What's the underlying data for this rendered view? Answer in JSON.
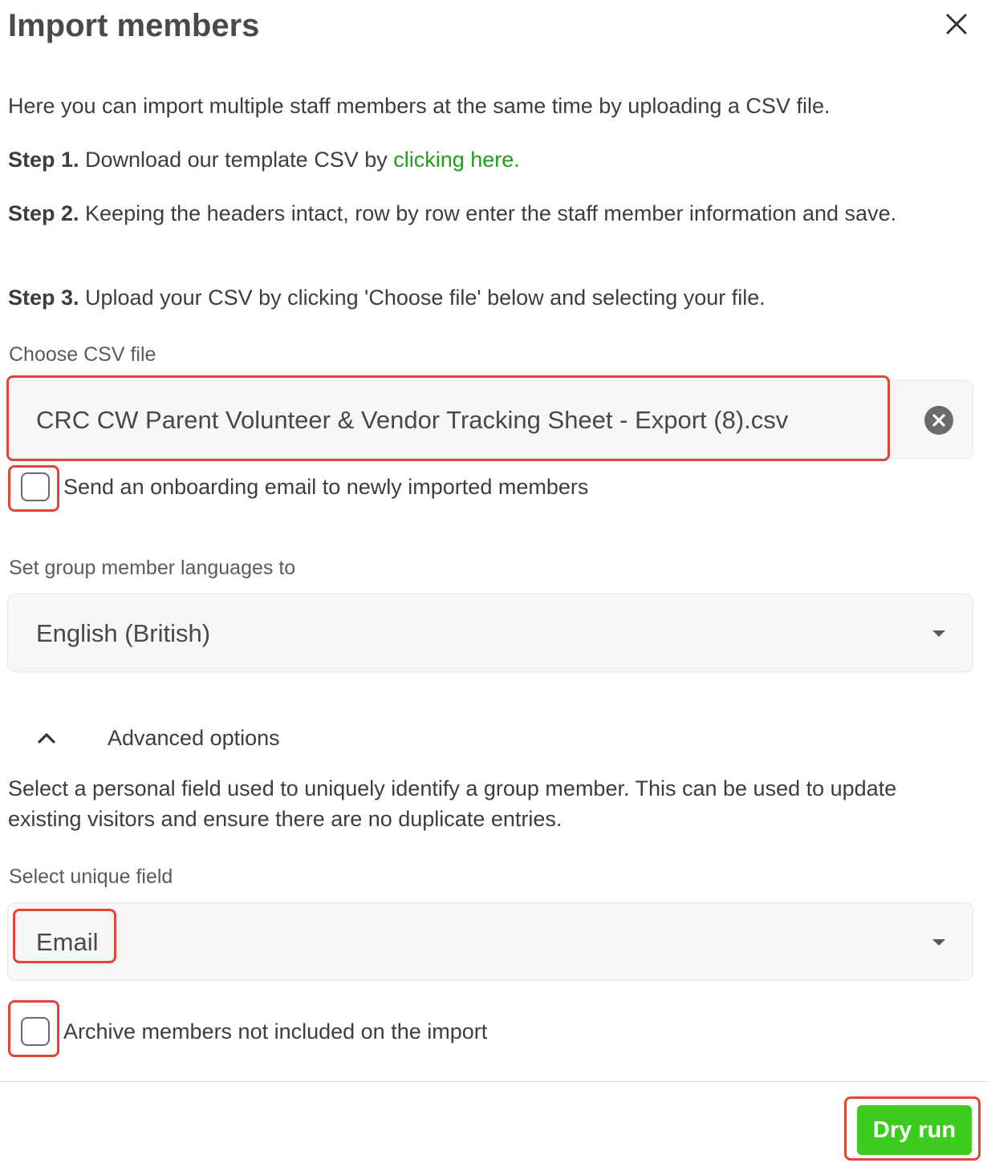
{
  "dialog": {
    "title": "Import members"
  },
  "intro": "Here you can import multiple staff members at the same time by uploading a CSV file.",
  "steps": {
    "step1_prefix": "Step 1.",
    "step1_text": " Download our template CSV by ",
    "step1_link": "clicking here.",
    "step2_prefix": "Step 2.",
    "step2_text": " Keeping the headers intact, row by row enter the staff member information and save.",
    "step3_prefix": "Step 3.",
    "step3_text": " Upload your CSV by clicking 'Choose file' below and selecting your file."
  },
  "file": {
    "label": "Choose CSV file",
    "value": "CRC CW Parent Volunteer & Vendor Tracking Sheet - Export (8).csv"
  },
  "onboarding": {
    "label": "Send an onboarding email to newly imported members",
    "checked": false
  },
  "language": {
    "label": "Set group member languages to",
    "value": "English (British)"
  },
  "advanced": {
    "toggle_label": "Advanced options",
    "description": "Select a personal field used to uniquely identify a group member. This can be used to update existing visitors and ensure there are no duplicate entries.",
    "unique_field_label": "Select unique field",
    "unique_field_value": "Email"
  },
  "archive": {
    "label": "Archive members not included on the import",
    "checked": false
  },
  "footer": {
    "dry_run_label": "Dry run"
  },
  "colors": {
    "accent_green": "#3ccc1e",
    "link_green": "#1e9e1e",
    "highlight_red": "#e0473a"
  },
  "icons": {
    "close": "close-icon",
    "clear": "clear-circle-icon",
    "caret": "caret-down-icon",
    "chevron": "chevron-up-icon"
  }
}
